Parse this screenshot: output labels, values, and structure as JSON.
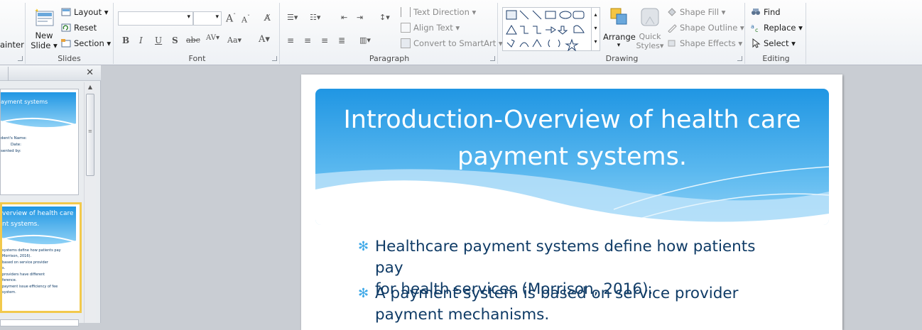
{
  "ribbon": {
    "painter_label": "ainter",
    "slides": {
      "group_label": "Slides",
      "new_slide_line1": "New",
      "new_slide_line2": "Slide",
      "layout": "Layout",
      "reset": "Reset",
      "section": "Section"
    },
    "font": {
      "group_label": "Font",
      "family_value": "",
      "size_value": ""
    },
    "paragraph": {
      "group_label": "Paragraph",
      "text_direction": "Text Direction",
      "align_text": "Align Text",
      "convert_smartart": "Convert to SmartArt"
    },
    "drawing": {
      "group_label": "Drawing",
      "arrange": "Arrange",
      "quick_styles_line1": "Quick",
      "quick_styles_line2": "Styles",
      "shape_fill": "Shape Fill",
      "shape_outline": "Shape Outline",
      "shape_effects": "Shape Effects"
    },
    "editing": {
      "group_label": "Editing",
      "find": "Find",
      "replace": "Replace",
      "select": "Select"
    }
  },
  "thumbnails": [
    {
      "title": "ayment systems",
      "lines": [
        "dent's Name:",
        "Date:",
        "sented by:"
      ]
    },
    {
      "title_line1": "verview  of health care",
      "title_line2": "nt systems.",
      "lines": [
        "systems define how patients pay",
        "Morrison, 2016).",
        "based on service provider",
        "s.",
        "providers have different",
        "ference.",
        "payment issue efficiency of fee",
        "system."
      ]
    }
  ],
  "slide": {
    "title_line1": "Introduction-Overview of health care",
    "title_line2": "payment systems.",
    "bullets": [
      {
        "line1": "Healthcare payment systems define how patients pay",
        "line2": "for health services (Morrison, 2016)."
      },
      {
        "line1": "A payment system is based on service provider",
        "line2": "payment mechanisms."
      }
    ]
  },
  "colors": {
    "header_top": "#2096e3",
    "header_bottom": "#8ed1f6",
    "bullet_text": "#0f3b66",
    "bullet_star": "#3fa9e8",
    "selected_thumb_border": "#f2c94c"
  }
}
